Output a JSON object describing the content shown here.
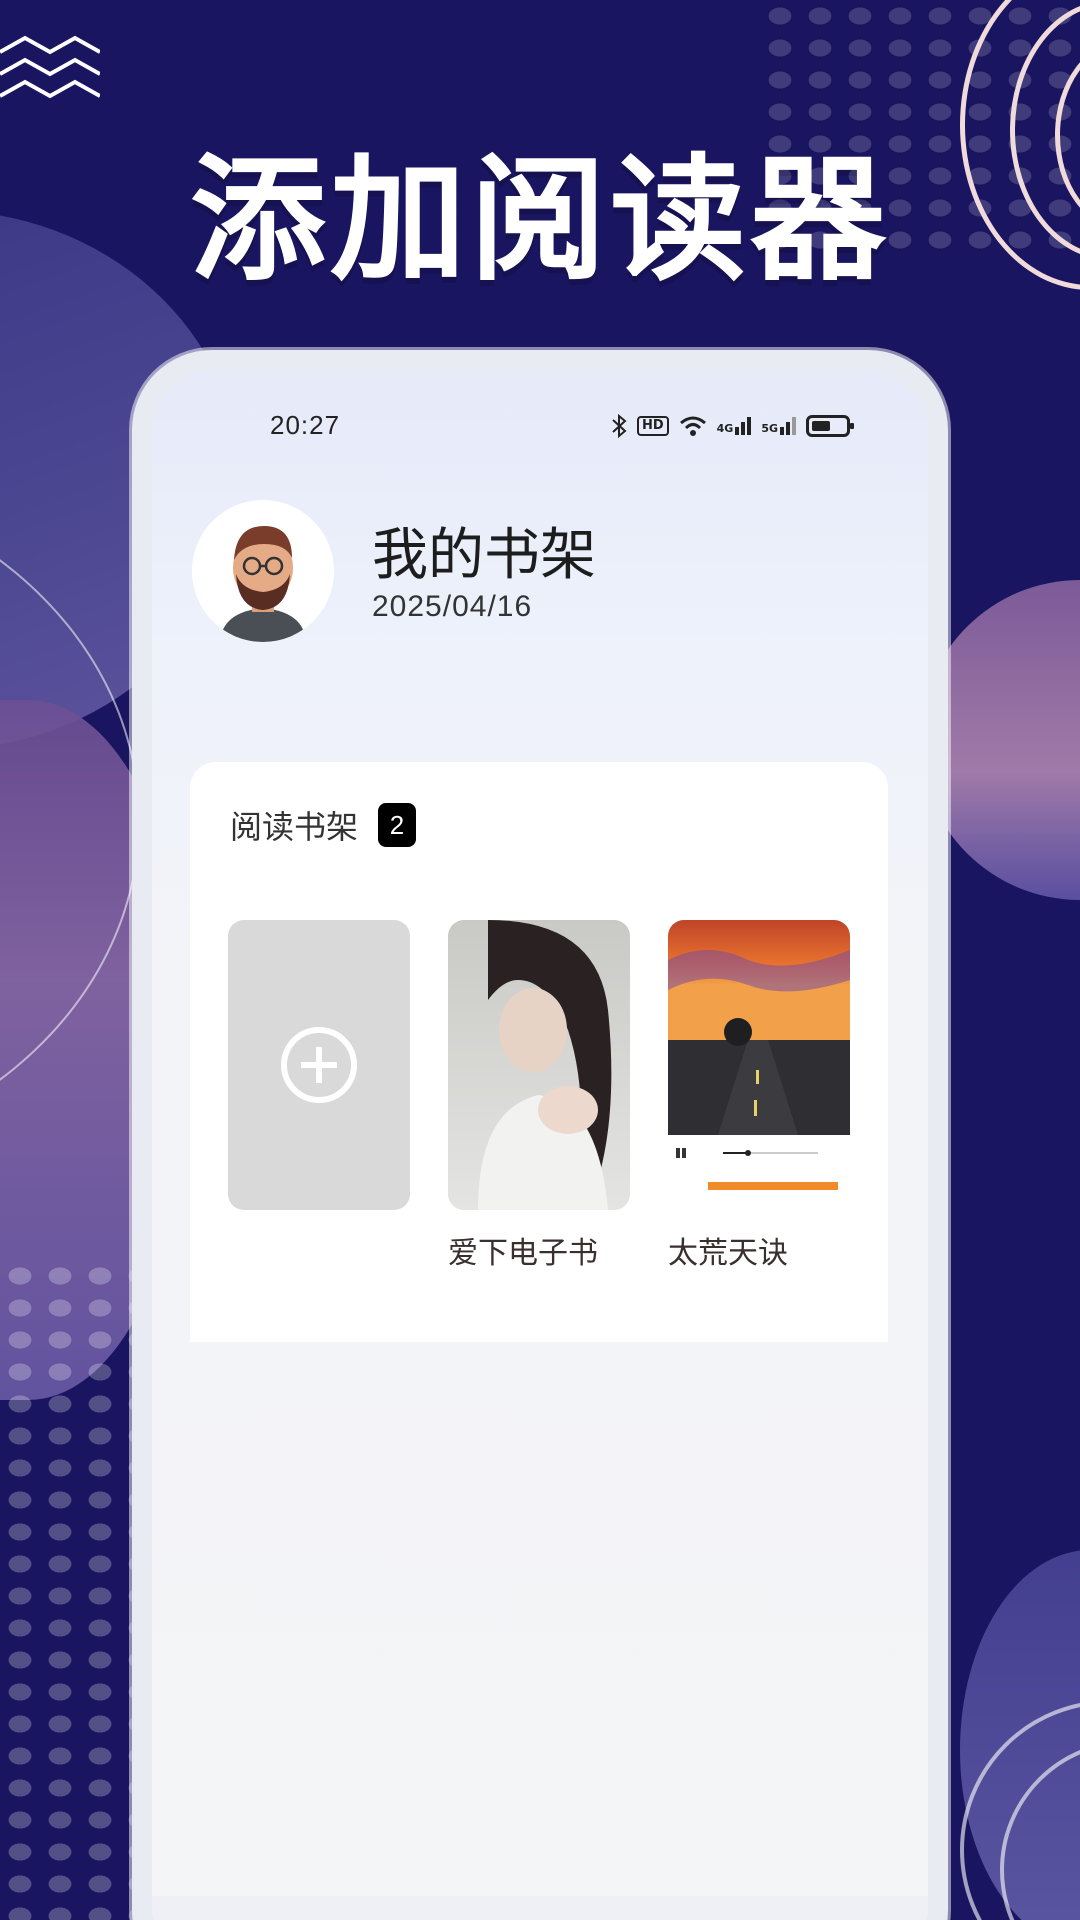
{
  "headline": "添加阅读器",
  "status_bar": {
    "time": "20:27",
    "hd_label": "HD",
    "net_4g": "4G",
    "net_5g": "5G"
  },
  "profile": {
    "title": "我的书架",
    "date": "2025/04/16"
  },
  "shelf_card": {
    "title": "阅读书架",
    "count": "2",
    "books": [
      {
        "name": "爱下电子书"
      },
      {
        "name": "太荒天诀"
      }
    ]
  },
  "bottom_nav": {
    "items": [
      {
        "icon": "home-icon"
      },
      {
        "icon": "bookshelf-icon",
        "active": true
      },
      {
        "icon": "book-icon"
      },
      {
        "icon": "profile-icon"
      }
    ]
  },
  "colors": {
    "background": "#1a1560",
    "accent_nav": "#4a90e2",
    "badge": "#000000"
  }
}
